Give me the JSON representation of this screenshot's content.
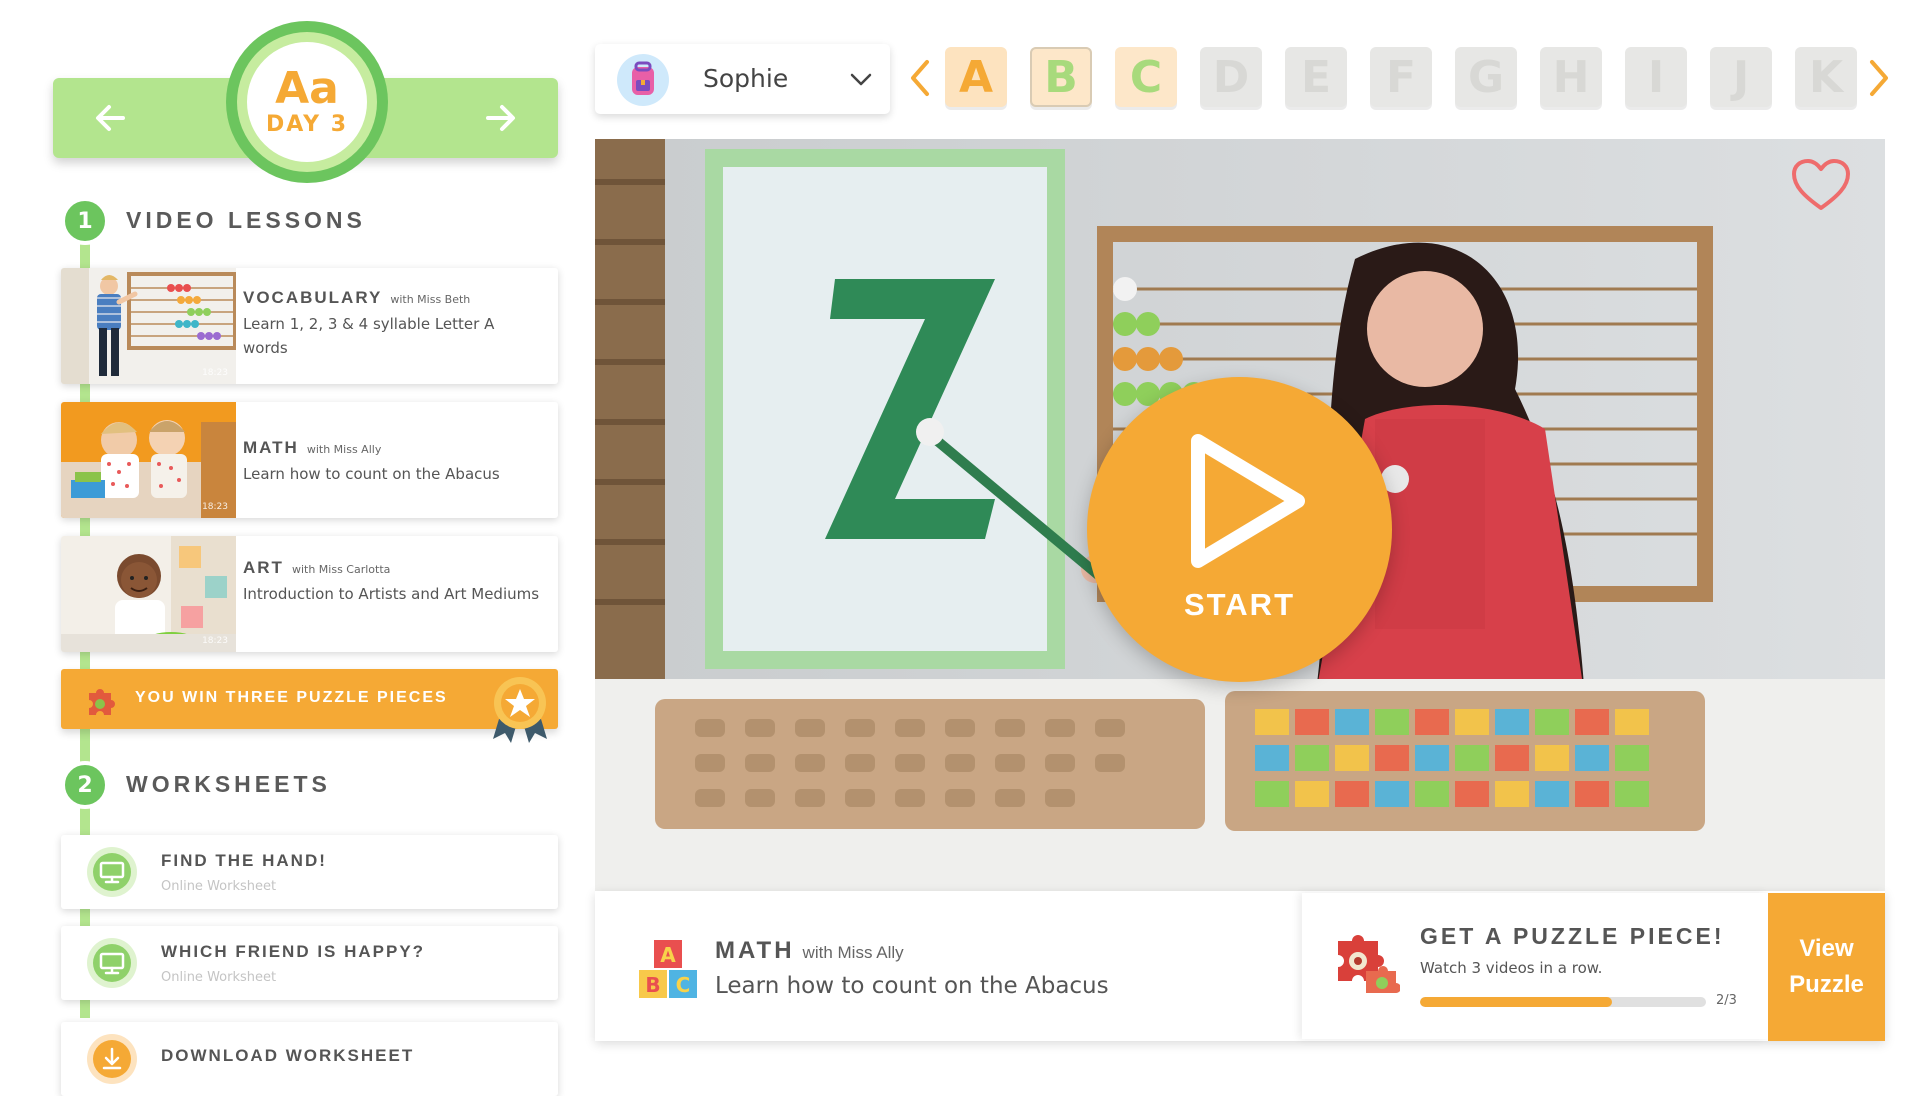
{
  "day": {
    "letters": "Aa",
    "label": "DAY 3"
  },
  "sections": {
    "videos": {
      "number": "1",
      "title": "VIDEO LESSONS"
    },
    "worksheets": {
      "number": "2",
      "title": "WORKSHEETS"
    }
  },
  "lessons": [
    {
      "subject": "VOCABULARY",
      "teacher": "with Miss Beth",
      "description": "Learn 1, 2, 3 & 4 syllable Letter A words",
      "duration": "18:23"
    },
    {
      "subject": "MATH",
      "teacher": "with Miss Ally",
      "description": "Learn how to count on the Abacus",
      "duration": "18:23"
    },
    {
      "subject": "ART",
      "teacher": "with Miss Carlotta",
      "description": "Introduction to Artists and Art Mediums",
      "duration": "18:23"
    }
  ],
  "reward": {
    "text": "YOU WIN THREE PUZZLE PIECES"
  },
  "worksheets": [
    {
      "title": "FIND THE HAND!",
      "subtitle": "Online Worksheet",
      "icon": "monitor-icon"
    },
    {
      "title": "WHICH FRIEND IS HAPPY?",
      "subtitle": "Online Worksheet",
      "icon": "monitor-icon"
    },
    {
      "title": "DOWNLOAD WORKSHEET",
      "subtitle": "",
      "icon": "download-icon"
    }
  ],
  "profile": {
    "name": "Sophie"
  },
  "letters": [
    "A",
    "B",
    "C",
    "D",
    "E",
    "F",
    "G",
    "H",
    "I",
    "J",
    "K"
  ],
  "letter_colors": {
    "active_bg": "#fde3bf",
    "active_fg": "#f5a935",
    "done_bg": "#fde7c9",
    "done_fg": "#a8da7c",
    "locked_bg": "#e7e7e5",
    "locked_fg": "#d8d8d5"
  },
  "video": {
    "play_label": "START",
    "favorite": "heart-icon"
  },
  "now_playing": {
    "subject": "MATH",
    "teacher": "with Miss Ally",
    "description": "Learn how to count on the Abacus"
  },
  "puzzle": {
    "title": "GET A PUZZLE PIECE!",
    "subtitle": "Watch 3 videos in a row.",
    "progress": "2/3",
    "progress_fraction": 0.67,
    "button": "View\nPuzzle"
  },
  "colors": {
    "green": "#6cc55e",
    "light_green": "#b3e58e",
    "orange": "#f5a935"
  }
}
